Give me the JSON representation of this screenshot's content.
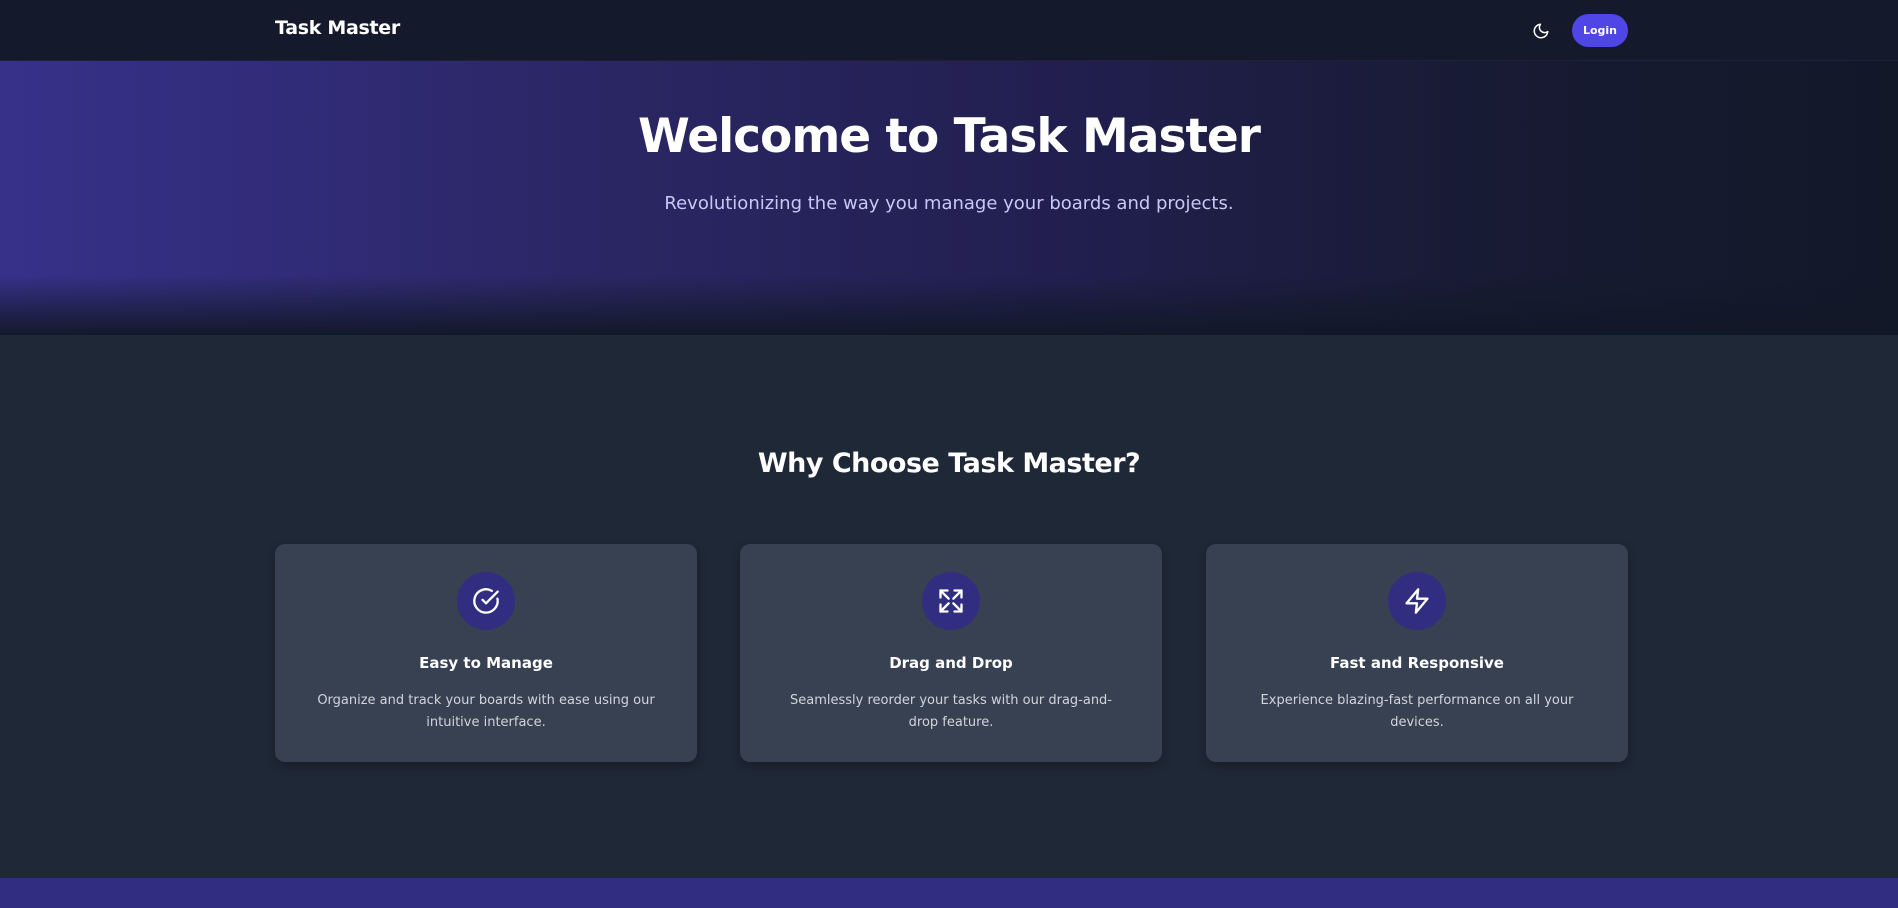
{
  "navbar": {
    "brand": "Task Master",
    "theme_toggle_icon": "moon-icon",
    "login_label": "Login"
  },
  "hero": {
    "title": "Welcome to Task Master",
    "subtitle": "Revolutionizing the way you manage your boards and projects."
  },
  "features": {
    "title": "Why Choose Task Master?",
    "cards": [
      {
        "icon": "check-circle-icon",
        "title": "Easy to Manage",
        "description": "Organize and track your boards with ease using our intuitive interface."
      },
      {
        "icon": "expand-arrows-icon",
        "title": "Drag and Drop",
        "description": "Seamlessly reorder your tasks with our drag-and-drop feature."
      },
      {
        "icon": "lightning-icon",
        "title": "Fast and Responsive",
        "description": "Experience blazing-fast performance on all your devices."
      }
    ]
  },
  "colors": {
    "accent": "#4f46e5",
    "icon_circle": "#312e81",
    "card_bg": "#374151",
    "page_bg": "#1f2837",
    "navbar_bg": "#141a2c"
  }
}
